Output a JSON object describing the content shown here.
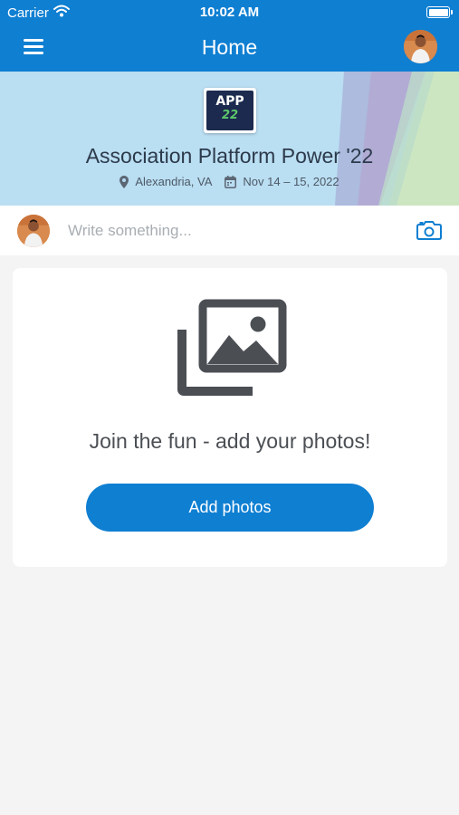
{
  "status_bar": {
    "carrier": "Carrier",
    "time": "10:02 AM"
  },
  "nav": {
    "title": "Home"
  },
  "event": {
    "logo_line1": "APP",
    "logo_line2": "22",
    "title": "Association Platform Power '22",
    "location": "Alexandria, VA",
    "dates": "Nov 14 – 15, 2022"
  },
  "composer": {
    "placeholder": "Write something..."
  },
  "empty_state": {
    "message": "Join the fun - add your photos!",
    "button_label": "Add photos"
  },
  "colors": {
    "brand_blue": "#0f7fd2",
    "background": "#f4f4f5"
  },
  "icons": [
    "menu-icon",
    "avatar",
    "location-pin-icon",
    "calendar-icon",
    "camera-icon",
    "photos-icon",
    "wifi-icon",
    "battery-icon"
  ]
}
